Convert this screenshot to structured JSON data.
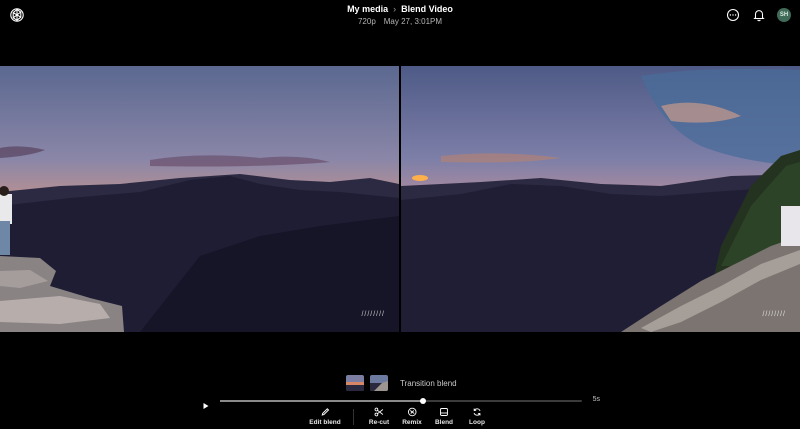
{
  "header": {
    "breadcrumb_root": "My media",
    "breadcrumb_separator": "›",
    "breadcrumb_current": "Blend Video",
    "resolution": "720p",
    "timestamp": "May 27, 3:01PM"
  },
  "header_icons": [
    "more-options-icon",
    "notifications-icon"
  ],
  "avatar": {
    "initials": "SH",
    "color": "#3f6b58"
  },
  "video": {
    "watermark_left": "////////",
    "watermark_right": "////////"
  },
  "clip": {
    "title": "Transition blend"
  },
  "timeline": {
    "duration": "5s",
    "progress": 0.56
  },
  "toolbar": {
    "edit_blend": "Edit blend",
    "recut": "Re-cut",
    "remix": "Remix",
    "blend": "Blend",
    "loop": "Loop"
  }
}
